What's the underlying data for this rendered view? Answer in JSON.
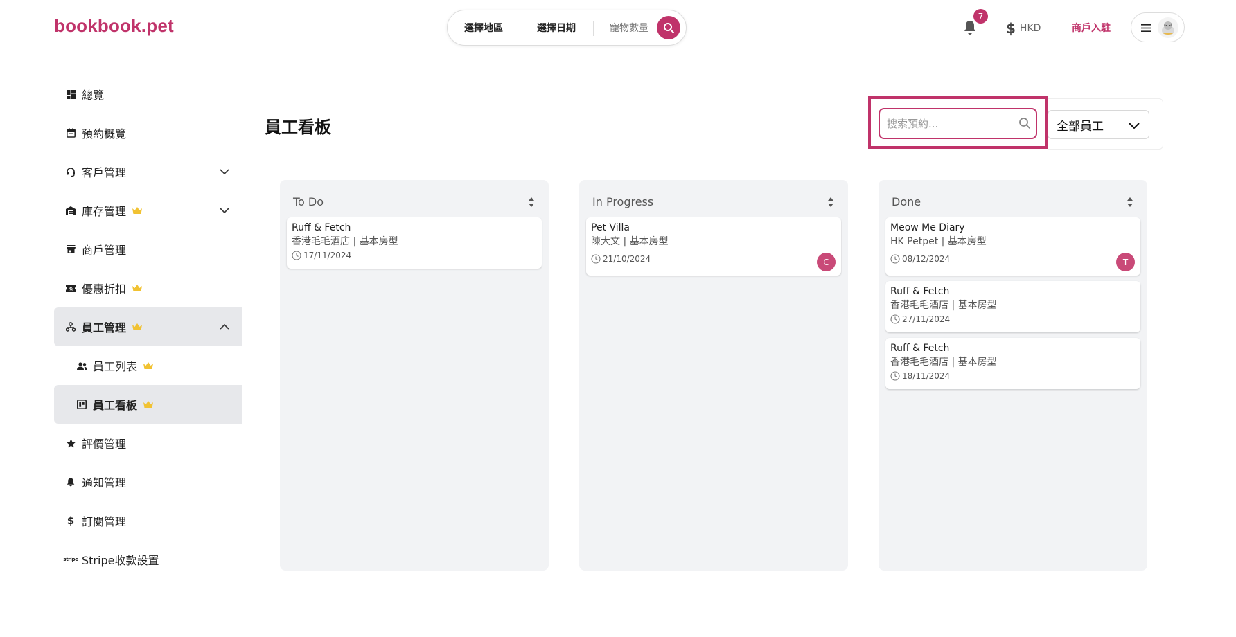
{
  "header": {
    "logo": "bookbook.pet",
    "search": {
      "region": "選擇地區",
      "date": "選擇日期",
      "pets": "寵物數量"
    },
    "notifications_count": "7",
    "currency": "HKD",
    "merchant_link": "商戶入駐",
    "icons": {
      "search": "search-icon",
      "bell": "bell-icon",
      "currency": "dollar-icon",
      "menu": "menu-icon"
    }
  },
  "sidebar": {
    "items": [
      {
        "label": "總覽",
        "icon": "dashboard-icon"
      },
      {
        "label": "預約概覽",
        "icon": "calendar-icon"
      },
      {
        "label": "客戶管理",
        "icon": "headset-icon",
        "expandable": true
      },
      {
        "label": "庫存管理",
        "icon": "warehouse-icon",
        "premium": true,
        "expandable": true
      },
      {
        "label": "商戶管理",
        "icon": "store-icon"
      },
      {
        "label": "優惠折扣",
        "icon": "ticket-icon",
        "premium": true
      },
      {
        "label": "員工管理",
        "icon": "org-chart-icon",
        "premium": true,
        "expanded": true,
        "active": true
      },
      {
        "label": "員工列表",
        "icon": "people-icon",
        "premium": true,
        "sub": true
      },
      {
        "label": "員工看板",
        "icon": "kanban-icon",
        "premium": true,
        "sub": true,
        "active": true
      },
      {
        "label": "評價管理",
        "icon": "star-icon"
      },
      {
        "label": "通知管理",
        "icon": "bell-icon"
      },
      {
        "label": "訂閱管理",
        "icon": "dollar-icon"
      },
      {
        "label": "Stripe收款設置",
        "icon": "stripe-icon"
      }
    ]
  },
  "main": {
    "title": "員工看板",
    "search_placeholder": "搜索預約...",
    "staff_filter": "全部員工",
    "columns": [
      {
        "title": "To Do",
        "cards": [
          {
            "title": "Ruff & Fetch",
            "subtitle": "香港毛毛酒店 | 基本房型",
            "date": "17/11/2024",
            "assignee": ""
          }
        ]
      },
      {
        "title": "In Progress",
        "cards": [
          {
            "title": "Pet Villa",
            "subtitle": "陳大文 | 基本房型",
            "date": "21/10/2024",
            "assignee": "C"
          }
        ]
      },
      {
        "title": "Done",
        "cards": [
          {
            "title": "Meow Me Diary",
            "subtitle": "HK Petpet | 基本房型",
            "date": "08/12/2024",
            "assignee": "T"
          },
          {
            "title": "Ruff & Fetch",
            "subtitle": "香港毛毛酒店 | 基本房型",
            "date": "27/11/2024",
            "assignee": ""
          },
          {
            "title": "Ruff & Fetch",
            "subtitle": "香港毛毛酒店 | 基本房型",
            "date": "18/11/2024",
            "assignee": ""
          }
        ]
      }
    ]
  },
  "colors": {
    "brand": "#c0336a",
    "crown": "#f1c232",
    "column_bg": "#f2f3f5",
    "active_nav_bg": "#e7e8eb"
  }
}
